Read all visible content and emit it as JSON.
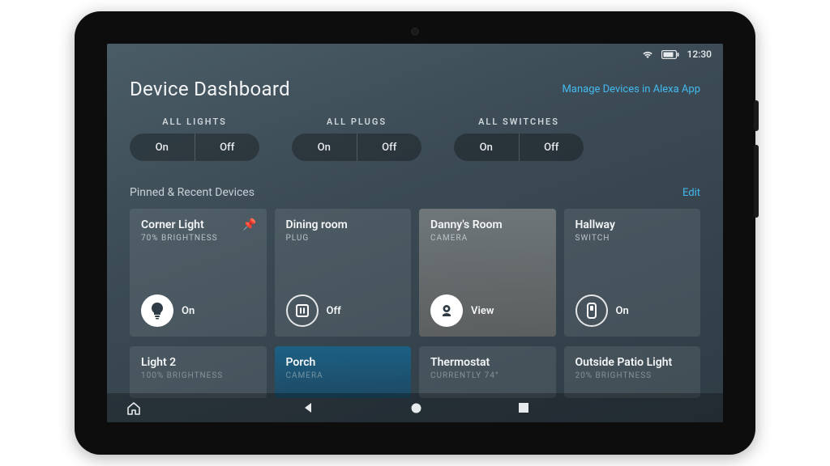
{
  "statusbar": {
    "time": "12:30"
  },
  "header": {
    "title": "Device Dashboard",
    "manage_link": "Manage Devices in Alexa App"
  },
  "groups": [
    {
      "label": "ALL LIGHTS",
      "on": "On",
      "off": "Off"
    },
    {
      "label": "ALL PLUGS",
      "on": "On",
      "off": "Off"
    },
    {
      "label": "ALL SWITCHES",
      "on": "On",
      "off": "Off"
    }
  ],
  "pinned": {
    "section_title": "Pinned & Recent Devices",
    "edit": "Edit"
  },
  "cards": [
    {
      "title": "Corner Light",
      "sub": "70% BRIGHTNESS",
      "action": "On",
      "icon": "bulb",
      "pinned": true
    },
    {
      "title": "Dining room",
      "sub": "PLUG",
      "action": "Off",
      "icon": "plug"
    },
    {
      "title": "Danny's Room",
      "sub": "CAMERA",
      "action": "View",
      "icon": "camera"
    },
    {
      "title": "Hallway",
      "sub": "SWITCH",
      "action": "On",
      "icon": "switch"
    }
  ],
  "cards2": [
    {
      "title": "Light 2",
      "sub": "100% BRIGHTNESS"
    },
    {
      "title": "Porch",
      "sub": "CAMERA"
    },
    {
      "title": "Thermostat",
      "sub": "CURRENTLY 74°"
    },
    {
      "title": "Outside Patio Light",
      "sub": "20% BRIGHTNESS"
    }
  ]
}
